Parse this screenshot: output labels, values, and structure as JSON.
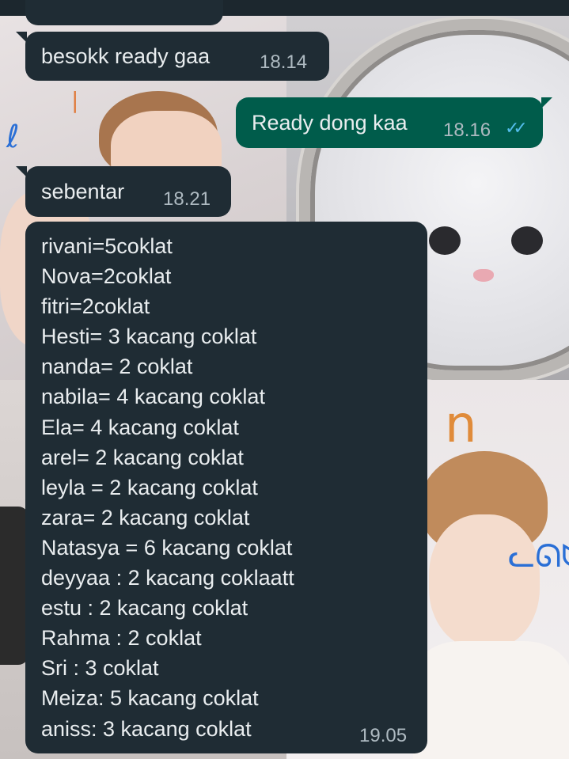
{
  "messages": [
    {
      "direction": "incoming",
      "text": "besokk ready gaa",
      "time": "18.14"
    },
    {
      "direction": "outgoing",
      "text": "Ready dong kaa",
      "time": "18.16",
      "status": "read",
      "status_icon": "double-check-icon"
    },
    {
      "direction": "incoming",
      "text": "sebentar",
      "time": "18.21"
    },
    {
      "direction": "incoming",
      "time": "19.05",
      "lines": [
        "rivani=5coklat",
        "Nova=2coklat",
        "fitri=2coklat",
        "Hesti= 3 kacang coklat",
        "nanda= 2 coklat",
        "nabila= 4 kacang coklat",
        "Ela= 4 kacang coklat",
        "arel= 2 kacang coklat",
        "leyla = 2 kacang coklat",
        "zara= 2 kacang coklat",
        "Natasya = 6 kacang coklat",
        "deyyaa : 2 kacang coklaatt",
        "estu : 2 kacang coklat",
        "Rahma : 2 coklat",
        "Sri : 3 coklat",
        "Meiza: 5 kacang coklat",
        "aniss: 3 kacang coklat"
      ]
    }
  ],
  "colors": {
    "incoming_bubble": "#1f2c34",
    "outgoing_bubble": "#005c4b",
    "text": "#e9edef",
    "timestamp": "#aebac1",
    "read_ticks": "#53bdeb"
  }
}
